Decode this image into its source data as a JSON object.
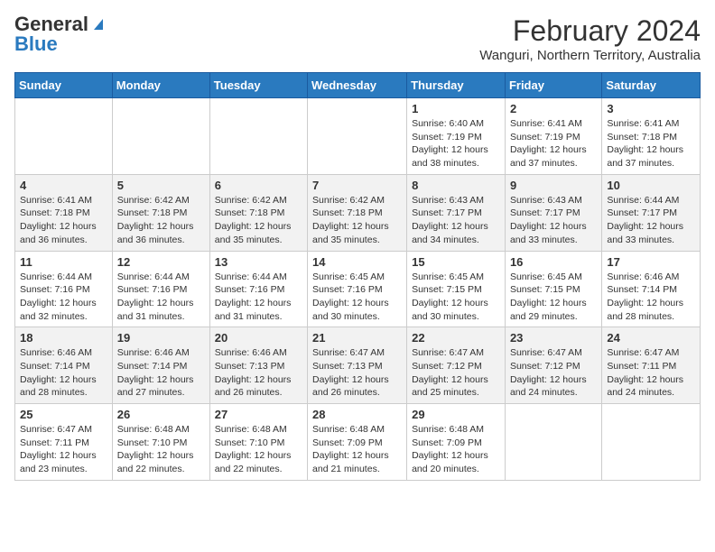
{
  "header": {
    "logo_general": "General",
    "logo_blue": "Blue",
    "title": "February 2024",
    "subtitle": "Wanguri, Northern Territory, Australia"
  },
  "calendar": {
    "days_of_week": [
      "Sunday",
      "Monday",
      "Tuesday",
      "Wednesday",
      "Thursday",
      "Friday",
      "Saturday"
    ],
    "weeks": [
      [
        {
          "day": "",
          "info": ""
        },
        {
          "day": "",
          "info": ""
        },
        {
          "day": "",
          "info": ""
        },
        {
          "day": "",
          "info": ""
        },
        {
          "day": "1",
          "info": "Sunrise: 6:40 AM\nSunset: 7:19 PM\nDaylight: 12 hours and 38 minutes."
        },
        {
          "day": "2",
          "info": "Sunrise: 6:41 AM\nSunset: 7:19 PM\nDaylight: 12 hours and 37 minutes."
        },
        {
          "day": "3",
          "info": "Sunrise: 6:41 AM\nSunset: 7:18 PM\nDaylight: 12 hours and 37 minutes."
        }
      ],
      [
        {
          "day": "4",
          "info": "Sunrise: 6:41 AM\nSunset: 7:18 PM\nDaylight: 12 hours and 36 minutes."
        },
        {
          "day": "5",
          "info": "Sunrise: 6:42 AM\nSunset: 7:18 PM\nDaylight: 12 hours and 36 minutes."
        },
        {
          "day": "6",
          "info": "Sunrise: 6:42 AM\nSunset: 7:18 PM\nDaylight: 12 hours and 35 minutes."
        },
        {
          "day": "7",
          "info": "Sunrise: 6:42 AM\nSunset: 7:18 PM\nDaylight: 12 hours and 35 minutes."
        },
        {
          "day": "8",
          "info": "Sunrise: 6:43 AM\nSunset: 7:17 PM\nDaylight: 12 hours and 34 minutes."
        },
        {
          "day": "9",
          "info": "Sunrise: 6:43 AM\nSunset: 7:17 PM\nDaylight: 12 hours and 33 minutes."
        },
        {
          "day": "10",
          "info": "Sunrise: 6:44 AM\nSunset: 7:17 PM\nDaylight: 12 hours and 33 minutes."
        }
      ],
      [
        {
          "day": "11",
          "info": "Sunrise: 6:44 AM\nSunset: 7:16 PM\nDaylight: 12 hours and 32 minutes."
        },
        {
          "day": "12",
          "info": "Sunrise: 6:44 AM\nSunset: 7:16 PM\nDaylight: 12 hours and 31 minutes."
        },
        {
          "day": "13",
          "info": "Sunrise: 6:44 AM\nSunset: 7:16 PM\nDaylight: 12 hours and 31 minutes."
        },
        {
          "day": "14",
          "info": "Sunrise: 6:45 AM\nSunset: 7:16 PM\nDaylight: 12 hours and 30 minutes."
        },
        {
          "day": "15",
          "info": "Sunrise: 6:45 AM\nSunset: 7:15 PM\nDaylight: 12 hours and 30 minutes."
        },
        {
          "day": "16",
          "info": "Sunrise: 6:45 AM\nSunset: 7:15 PM\nDaylight: 12 hours and 29 minutes."
        },
        {
          "day": "17",
          "info": "Sunrise: 6:46 AM\nSunset: 7:14 PM\nDaylight: 12 hours and 28 minutes."
        }
      ],
      [
        {
          "day": "18",
          "info": "Sunrise: 6:46 AM\nSunset: 7:14 PM\nDaylight: 12 hours and 28 minutes."
        },
        {
          "day": "19",
          "info": "Sunrise: 6:46 AM\nSunset: 7:14 PM\nDaylight: 12 hours and 27 minutes."
        },
        {
          "day": "20",
          "info": "Sunrise: 6:46 AM\nSunset: 7:13 PM\nDaylight: 12 hours and 26 minutes."
        },
        {
          "day": "21",
          "info": "Sunrise: 6:47 AM\nSunset: 7:13 PM\nDaylight: 12 hours and 26 minutes."
        },
        {
          "day": "22",
          "info": "Sunrise: 6:47 AM\nSunset: 7:12 PM\nDaylight: 12 hours and 25 minutes."
        },
        {
          "day": "23",
          "info": "Sunrise: 6:47 AM\nSunset: 7:12 PM\nDaylight: 12 hours and 24 minutes."
        },
        {
          "day": "24",
          "info": "Sunrise: 6:47 AM\nSunset: 7:11 PM\nDaylight: 12 hours and 24 minutes."
        }
      ],
      [
        {
          "day": "25",
          "info": "Sunrise: 6:47 AM\nSunset: 7:11 PM\nDaylight: 12 hours and 23 minutes."
        },
        {
          "day": "26",
          "info": "Sunrise: 6:48 AM\nSunset: 7:10 PM\nDaylight: 12 hours and 22 minutes."
        },
        {
          "day": "27",
          "info": "Sunrise: 6:48 AM\nSunset: 7:10 PM\nDaylight: 12 hours and 22 minutes."
        },
        {
          "day": "28",
          "info": "Sunrise: 6:48 AM\nSunset: 7:09 PM\nDaylight: 12 hours and 21 minutes."
        },
        {
          "day": "29",
          "info": "Sunrise: 6:48 AM\nSunset: 7:09 PM\nDaylight: 12 hours and 20 minutes."
        },
        {
          "day": "",
          "info": ""
        },
        {
          "day": "",
          "info": ""
        }
      ]
    ]
  }
}
